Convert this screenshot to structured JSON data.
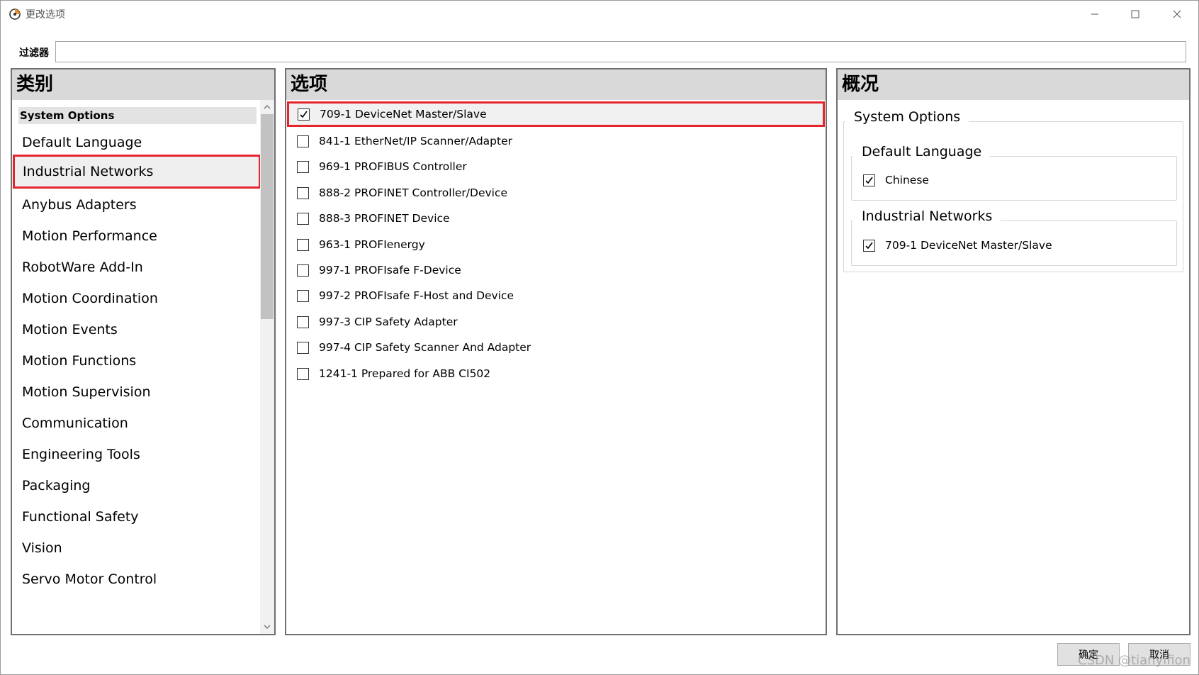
{
  "window": {
    "title": "更改选项"
  },
  "filter": {
    "label": "过滤器",
    "value": "",
    "placeholder": ""
  },
  "categories": {
    "header": "类别",
    "group": "System Options",
    "items": [
      {
        "label": "Default Language"
      },
      {
        "label": "Industrial Networks",
        "selected": true
      },
      {
        "label": "Anybus Adapters"
      },
      {
        "label": "Motion Performance"
      },
      {
        "label": "RobotWare Add-In"
      },
      {
        "label": "Motion Coordination"
      },
      {
        "label": "Motion Events"
      },
      {
        "label": "Motion Functions"
      },
      {
        "label": "Motion Supervision"
      },
      {
        "label": "Communication"
      },
      {
        "label": "Engineering Tools"
      },
      {
        "label": "Packaging"
      },
      {
        "label": "Functional Safety"
      },
      {
        "label": "Vision"
      },
      {
        "label": "Servo Motor Control"
      }
    ]
  },
  "options": {
    "header": "选项",
    "items": [
      {
        "label": "709-1 DeviceNet Master/Slave",
        "checked": true,
        "selected": true
      },
      {
        "label": "841-1 EtherNet/IP Scanner/Adapter",
        "checked": false
      },
      {
        "label": "969-1 PROFIBUS Controller",
        "checked": false
      },
      {
        "label": "888-2 PROFINET Controller/Device",
        "checked": false
      },
      {
        "label": "888-3 PROFINET Device",
        "checked": false
      },
      {
        "label": "963-1 PROFIenergy",
        "checked": false
      },
      {
        "label": "997-1 PROFIsafe F-Device",
        "checked": false
      },
      {
        "label": "997-2 PROFIsafe F-Host and Device",
        "checked": false
      },
      {
        "label": "997-3 CIP Safety Adapter",
        "checked": false
      },
      {
        "label": "997-4 CIP Safety Scanner And Adapter",
        "checked": false
      },
      {
        "label": "1241-1 Prepared for ABB CI502",
        "checked": false
      }
    ]
  },
  "summary": {
    "header": "概况",
    "group_title": "System Options",
    "sections": [
      {
        "title": "Default Language",
        "item": "Chinese"
      },
      {
        "title": "Industrial Networks",
        "item": "709-1 DeviceNet Master/Slave"
      }
    ]
  },
  "buttons": {
    "ok": "确定",
    "cancel": "取消"
  },
  "watermark": "CSDN @tianyifion",
  "colors": {
    "highlight": "#e3262e",
    "panel_header": "#d9d9d9"
  }
}
